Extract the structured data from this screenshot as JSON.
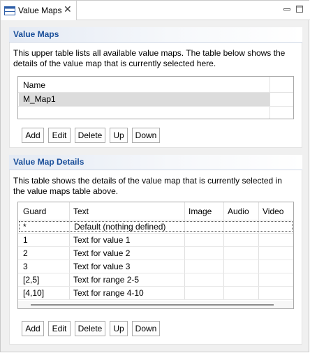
{
  "tab": {
    "label": "Value Maps",
    "close": "✕"
  },
  "maps_section": {
    "title": "Value Maps",
    "description": "This upper table lists all available value maps. The table below shows the details of the value map that is currently selected here.",
    "column_name": "Name",
    "rows": [
      "M_Map1"
    ],
    "buttons": {
      "add": "Add",
      "edit": "Edit",
      "delete": "Delete",
      "up": "Up",
      "down": "Down"
    }
  },
  "details_section": {
    "title": "Value Map Details",
    "description": "This table shows the details of the value map that is currently selected in the value maps table above.",
    "columns": {
      "guard": "Guard",
      "text": "Text",
      "image": "Image",
      "audio": "Audio",
      "video": "Video"
    },
    "rows": [
      {
        "guard": "*",
        "text": "Default (nothing defined)"
      },
      {
        "guard": "1",
        "text": "Text for value 1"
      },
      {
        "guard": "2",
        "text": "Text for value 2"
      },
      {
        "guard": "3",
        "text": "Text for value 3"
      },
      {
        "guard": "[2,5]",
        "text": "Text for range 2-5"
      },
      {
        "guard": "[4,10]",
        "text": "Text for range 4-10"
      }
    ],
    "buttons": {
      "add": "Add",
      "edit": "Edit",
      "delete": "Delete",
      "up": "Up",
      "down": "Down"
    }
  },
  "colors": {
    "accent": "#1a4f9a",
    "selection": "#dcdcdc"
  },
  "icons": {
    "tab": "table-view-icon",
    "minimize": "minimize-icon",
    "maximize": "maximize-icon"
  }
}
